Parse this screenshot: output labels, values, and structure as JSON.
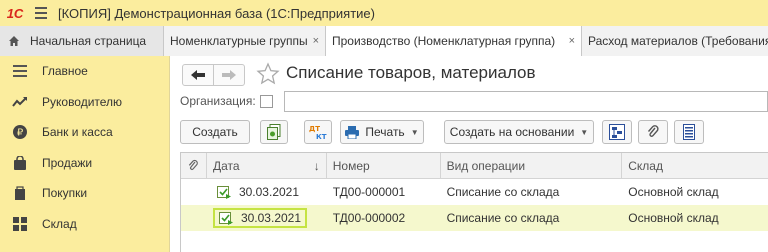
{
  "app": {
    "logo": "1С",
    "title": "[КОПИЯ] Демонстрационная база (1С:Предприятие)"
  },
  "tabs": [
    {
      "label": "Начальная страница"
    },
    {
      "label": "Номенклатурные группы",
      "close": "×"
    },
    {
      "label": "Производство (Номенклатурная группа)",
      "close": "×"
    },
    {
      "label": "Расход материалов (Требования"
    }
  ],
  "sidebar": {
    "items": [
      {
        "label": "Главное",
        "icon": "menu-icon"
      },
      {
        "label": "Руководителю",
        "icon": "trend-icon"
      },
      {
        "label": "Банк и касса",
        "icon": "ruble-icon"
      },
      {
        "label": "Продажи",
        "icon": "shopping-bag-icon"
      },
      {
        "label": "Покупки",
        "icon": "cart-icon"
      },
      {
        "label": "Склад",
        "icon": "warehouse-icon"
      }
    ]
  },
  "form": {
    "title": "Списание товаров, материалов",
    "org_label": "Организация:",
    "org_value": ""
  },
  "toolbar": {
    "create_label": "Создать",
    "print_label": "Печать",
    "create_based_label": "Создать на основании",
    "dtkt_label_top": "ДТ",
    "dtkt_label_bottom": "КТ"
  },
  "table": {
    "columns": [
      "Дата",
      "Номер",
      "Вид операции",
      "Склад"
    ],
    "sort_indicator": "↓",
    "rows": [
      {
        "date": "30.03.2021",
        "number": "ТД00-000001",
        "operation": "Списание со склада",
        "warehouse": "Основной склад"
      },
      {
        "date": "30.03.2021",
        "number": "ТД00-000002",
        "operation": "Списание со склада",
        "warehouse": "Основной склад"
      }
    ]
  },
  "colors": {
    "accent_yellow": "#fbed9e",
    "selected_row": "#f5f8cd",
    "focus_border": "#c5e342",
    "logo_red": "#d9261c"
  }
}
